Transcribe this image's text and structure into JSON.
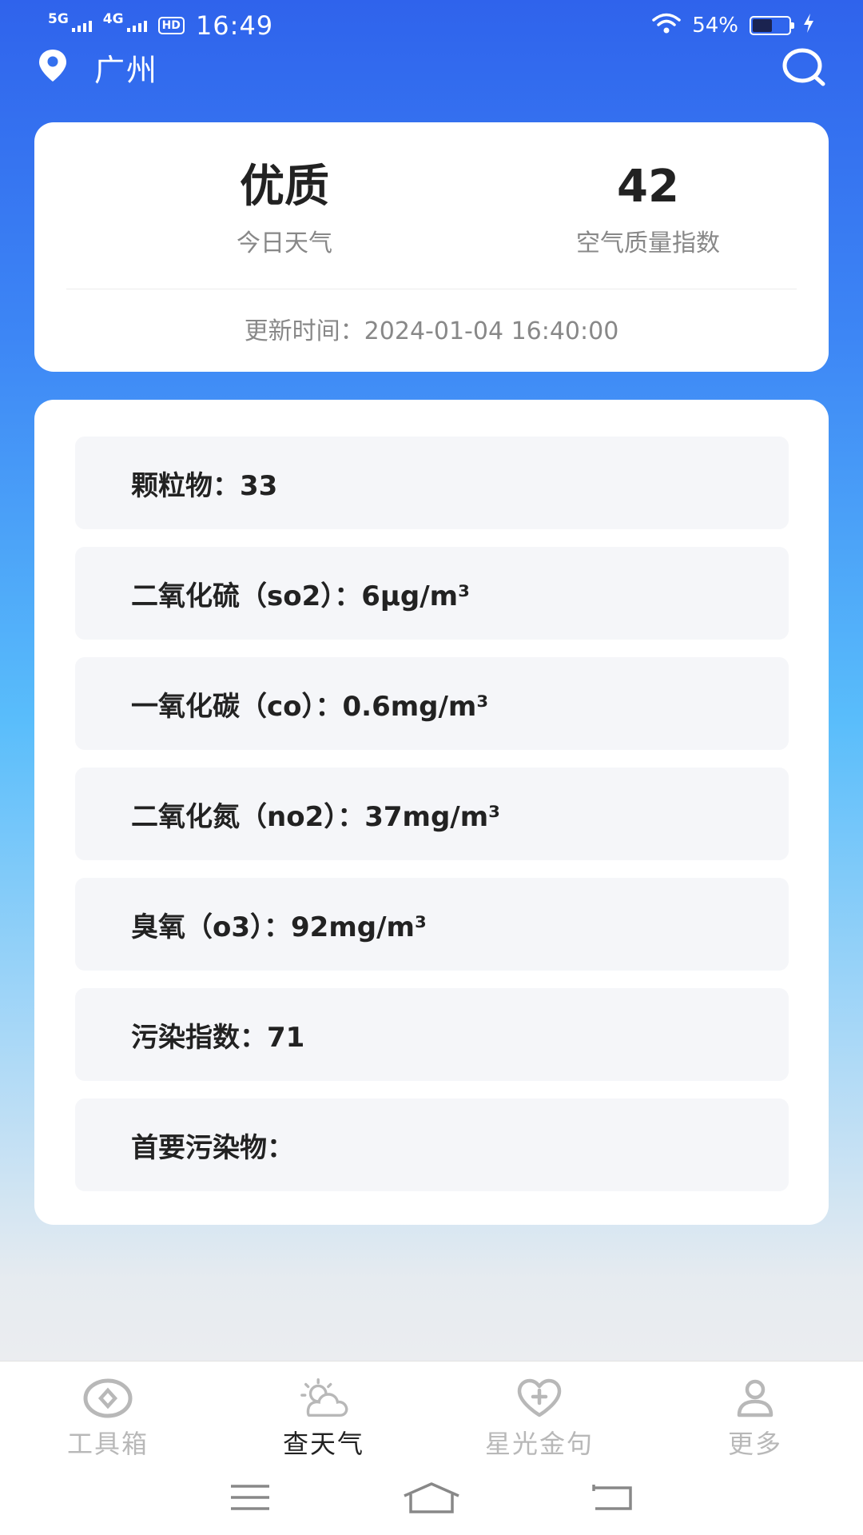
{
  "status_bar": {
    "net1": "5G",
    "net2": "4G",
    "hd": "HD",
    "time": "16:49",
    "battery_text": "54%",
    "battery_level": 0.54
  },
  "header": {
    "city": "广州",
    "location_icon": "location-pin-icon",
    "search_icon": "search-icon"
  },
  "aqi": {
    "weather_value": "优质",
    "weather_label": "今日天气",
    "aqi_value": "42",
    "aqi_label": "空气质量指数",
    "update_text": "更新时间：2024-01-04 16:40:00"
  },
  "details": [
    {
      "text": "颗粒物：33"
    },
    {
      "text": "二氧化硫（so2）：6μg/m³"
    },
    {
      "text": "一氧化碳（co）：0.6mg/m³"
    },
    {
      "text": "二氧化氮（no2）：37mg/m³"
    },
    {
      "text": "臭氧（o3）：92mg/m³"
    },
    {
      "text": "污染指数：71"
    },
    {
      "text": "首要污染物："
    }
  ],
  "nav": {
    "tabs": [
      {
        "label": "工具箱",
        "icon": "toolbox-icon",
        "active": false
      },
      {
        "label": "查天气",
        "icon": "weather-icon",
        "active": true
      },
      {
        "label": "星光金句",
        "icon": "heart-plus-icon",
        "active": false
      },
      {
        "label": "更多",
        "icon": "user-icon",
        "active": false
      }
    ]
  },
  "colors": {
    "gradient_top": "#2f63ec",
    "gradient_mid": "#59bdfb",
    "page_bottom": "#ebedf0",
    "active_tab": "#222222",
    "inactive_tab": "#b8b8b8"
  }
}
